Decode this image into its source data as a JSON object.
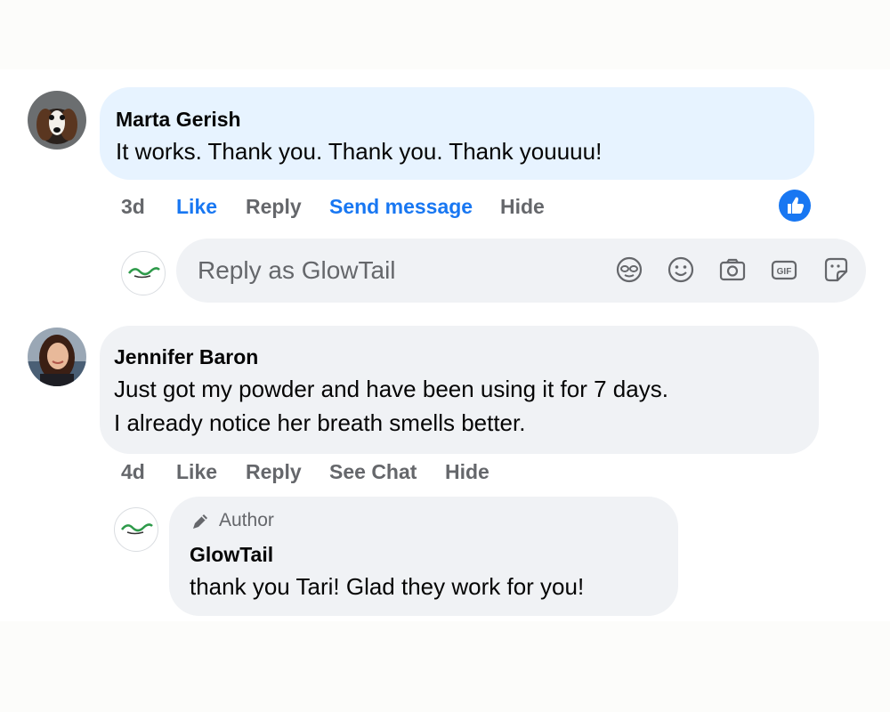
{
  "comments": [
    {
      "author": "Marta Gerish",
      "text": "It works. Thank you. Thank you. Thank youuuu!",
      "actions": {
        "time": "3d",
        "like": "Like",
        "reply": "Reply",
        "message": "Send message",
        "hide": "Hide"
      },
      "liked": true
    },
    {
      "author": "Jennifer Baron",
      "text_lines": [
        "Just got my powder and have been using it for 7 days.",
        "I already notice her breath smells better."
      ],
      "actions": {
        "time": "4d",
        "like": "Like",
        "reply": "Reply",
        "chat": "See Chat",
        "hide": "Hide"
      }
    }
  ],
  "reply_input": {
    "placeholder": "Reply as GlowTail"
  },
  "author_reply": {
    "badge": "Author",
    "author": "GlowTail",
    "text": "thank you Tari! Glad they work for you!"
  },
  "colors": {
    "own_comment_bg": "#e7f3ff",
    "comment_bg": "#f0f2f5",
    "accent": "#1877f2",
    "muted": "#65676b"
  },
  "icons": [
    "avatar-icon-sticker",
    "emoji-icon",
    "camera-icon",
    "gif-icon",
    "sticker-icon",
    "like-icon",
    "pencil-icon"
  ]
}
